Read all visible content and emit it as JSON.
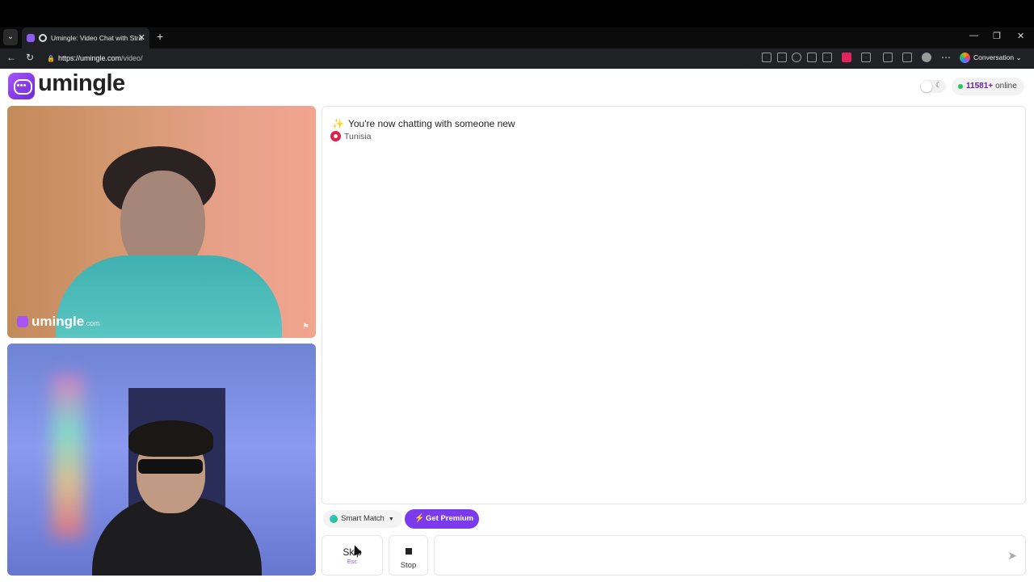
{
  "browser": {
    "tab_title": "Umingle: Video Chat with Stra",
    "url_host": "https://umingle.com",
    "url_path": "/video/",
    "copilot_label": "Conversation"
  },
  "header": {
    "logo_text": "umingle",
    "online_count": "11581+",
    "online_label": "online"
  },
  "video": {
    "watermark": "umingle",
    "watermark_suffix": ".com"
  },
  "chat": {
    "system_message": "You're now chatting with someone new",
    "country": "Tunisia"
  },
  "controls": {
    "match_mode": "Smart Match",
    "premium_label": "Get Premium",
    "skip_label": "Skip",
    "skip_key": "Esc",
    "stop_label": "Stop",
    "message_placeholder": ""
  },
  "colors": {
    "brand": "#7c3aed",
    "online_dot": "#22c55e"
  }
}
